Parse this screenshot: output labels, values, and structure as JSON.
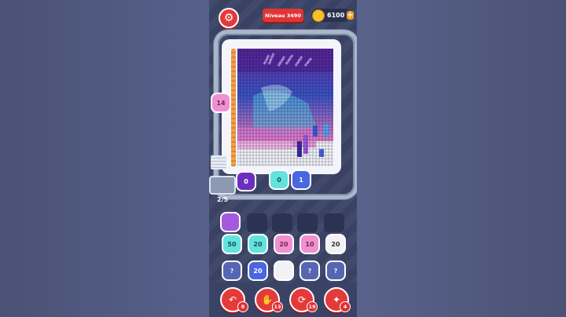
{
  "header": {
    "level_label": "Niveau 3490",
    "coins": "6100",
    "coins_plus": "+"
  },
  "board": {
    "side_counter": "14",
    "conveyor_figures": [
      "0",
      "0",
      "1"
    ],
    "progress": "2/5"
  },
  "queue": {
    "row1": [
      "50",
      "20",
      "20",
      "10",
      "20"
    ],
    "row2": [
      "?",
      "20",
      "",
      "?",
      "?"
    ],
    "row3": [
      "?",
      "?",
      "",
      "",
      ""
    ]
  },
  "colors": {
    "accent_red": "#e23a3a",
    "coin": "#f6c12b"
  },
  "toolbar": {
    "items": [
      {
        "icon": "undo-icon",
        "badge": "8"
      },
      {
        "icon": "hand-icon",
        "badge": "13"
      },
      {
        "icon": "shuffle-icon",
        "badge": "19"
      },
      {
        "icon": "magic-icon",
        "badge": "4"
      }
    ]
  }
}
